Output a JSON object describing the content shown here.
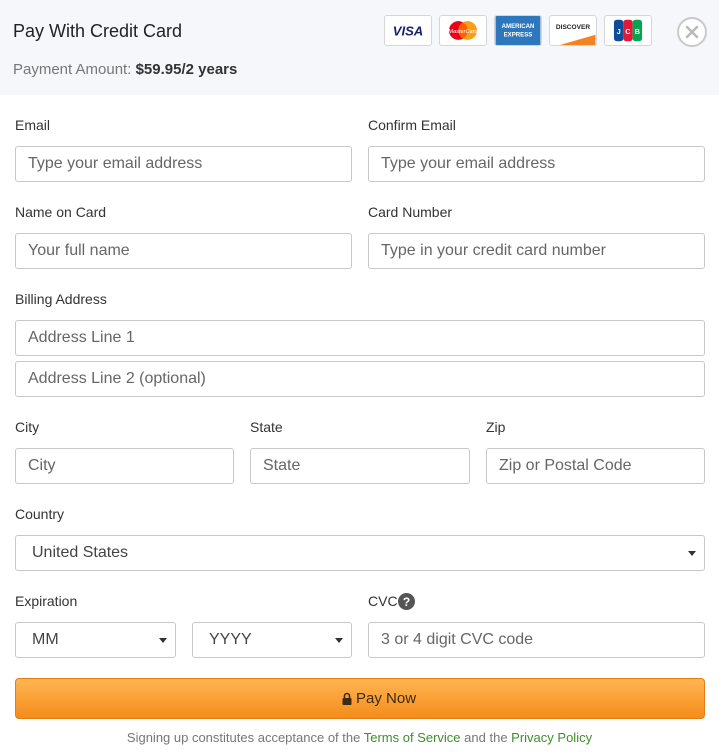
{
  "header": {
    "title": "Pay With Credit Card",
    "amount_label": "Payment Amount:",
    "amount_value": "$59.95/2 years",
    "cards": [
      {
        "name": "VISA",
        "color": "#1a1f71"
      },
      {
        "name": "MasterCard",
        "color": "#eb001b"
      },
      {
        "name": "AMERICAN EXPRESS",
        "color": "#2e77bc"
      },
      {
        "name": "DISCOVER",
        "color": "#f58220"
      },
      {
        "name": "JCB",
        "color": "#0e4c96"
      }
    ]
  },
  "form": {
    "email": {
      "label": "Email",
      "placeholder": "Type your email address"
    },
    "confirm_email": {
      "label": "Confirm Email",
      "placeholder": "Type your email address"
    },
    "name_on_card": {
      "label": "Name on Card",
      "placeholder": "Your full name"
    },
    "card_number": {
      "label": "Card Number",
      "placeholder": "Type in your credit card number"
    },
    "billing": {
      "label": "Billing Address",
      "line1_placeholder": "Address Line 1",
      "line2_placeholder": "Address Line 2 (optional)"
    },
    "city": {
      "label": "City",
      "placeholder": "City"
    },
    "state": {
      "label": "State",
      "placeholder": "State"
    },
    "zip": {
      "label": "Zip",
      "placeholder": "Zip or Postal Code"
    },
    "country": {
      "label": "Country",
      "value": "United States"
    },
    "expiration": {
      "label": "Expiration",
      "month": "MM",
      "year": "YYYY"
    },
    "cvc": {
      "label": "CVC",
      "placeholder": "3 or 4 digit CVC code"
    }
  },
  "pay_button": {
    "label": "Pay Now",
    "color": "#f7a133"
  },
  "terms": {
    "prefix": "Signing up constitutes acceptance of the",
    "tos": "Terms of Service",
    "middle": "and the",
    "privacy": "Privacy Policy",
    "link_color": "#3f8d2c"
  }
}
